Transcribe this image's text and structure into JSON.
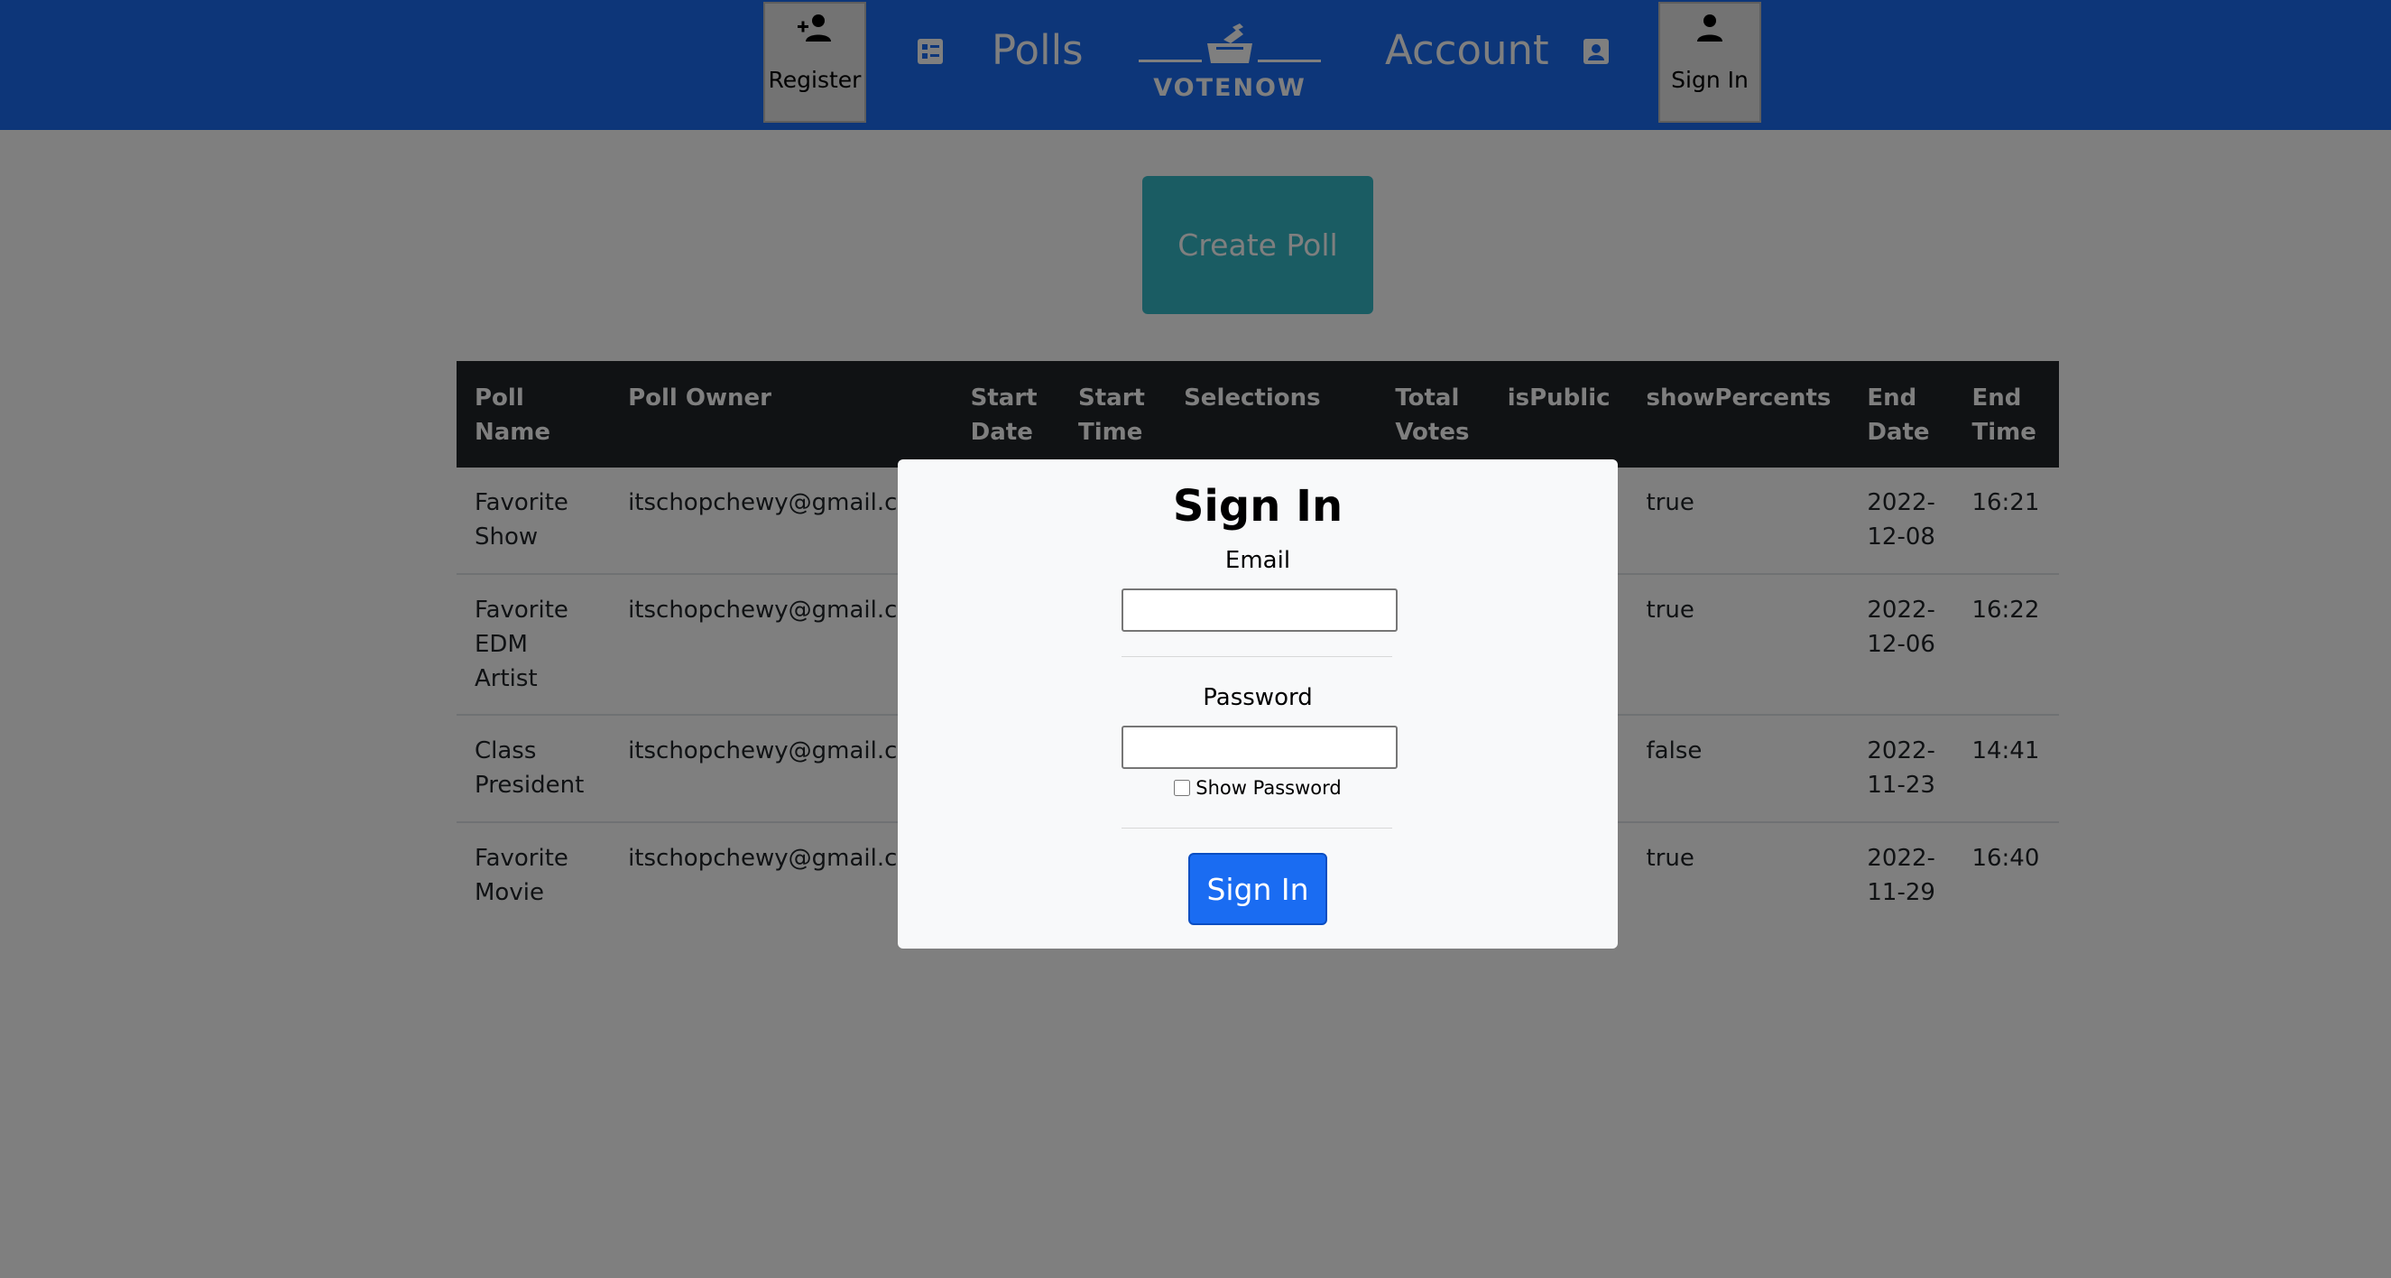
{
  "nav": {
    "register_label": "Register",
    "polls_label": "Polls",
    "logo_text": "VOTENOW",
    "account_label": "Account",
    "signin_label": "Sign In"
  },
  "main": {
    "create_poll_label": "Create Poll"
  },
  "table": {
    "headers": [
      "Poll Name",
      "Poll Owner",
      "Start Date",
      "Start Time",
      "Selections",
      "Total Votes",
      "isPublic",
      "showPercents",
      "End Date",
      "End Time"
    ],
    "rows": [
      {
        "poll_name": "Favorite Show",
        "owner": "itschopchewy@gmail.com",
        "show_percents": "true",
        "end_date": "2022-12-08",
        "end_time": "16:21"
      },
      {
        "poll_name": "Favorite EDM Artist",
        "owner": "itschopchewy@gmail.com",
        "show_percents": "true",
        "end_date": "2022-12-06",
        "end_time": "16:22"
      },
      {
        "poll_name": "Class President",
        "owner": "itschopchewy@gmail.com",
        "show_percents": "false",
        "end_date": "2022-11-23",
        "end_time": "14:41"
      },
      {
        "poll_name": "Favorite Movie",
        "owner": "itschopchewy@gmail.com",
        "show_percents": "true",
        "end_date": "2022-11-29",
        "end_time": "16:40"
      }
    ]
  },
  "modal": {
    "title": "Sign In",
    "email_label": "Email",
    "email_value": "",
    "password_label": "Password",
    "password_value": "",
    "show_password_label": "Show Password",
    "show_password_checked": false,
    "submit_label": "Sign In"
  },
  "icons": {
    "register": "person-add-icon",
    "polls": "list-check-icon",
    "logo": "ballot-box-icon",
    "account": "contact-card-icon",
    "signin": "person-icon"
  },
  "colors": {
    "navbar": "#1a6cf2",
    "create_poll": "#35b9c7",
    "table_header": "#212529",
    "primary_button": "#1a6cf2"
  }
}
